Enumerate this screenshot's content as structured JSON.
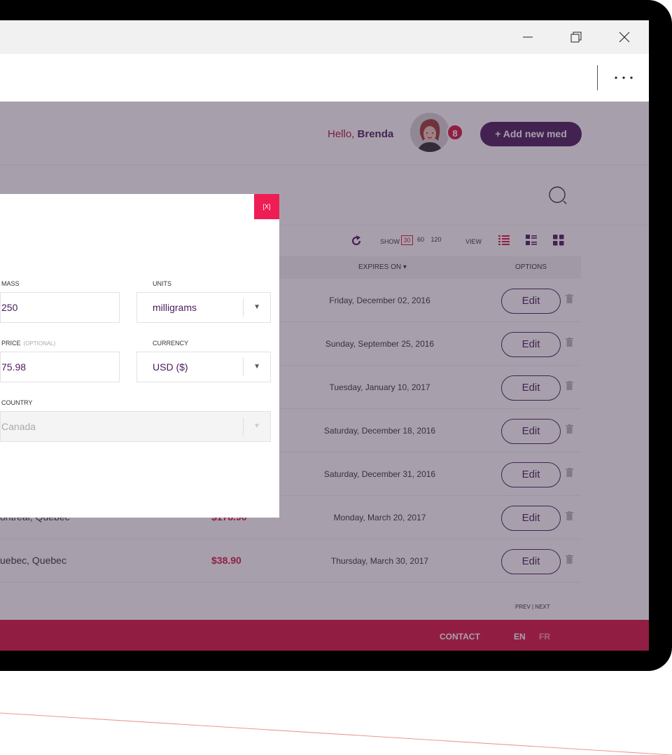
{
  "header": {
    "greeting": "Hello,",
    "user_name": "Brenda",
    "notification_count": "8",
    "add_button": "+ Add new med"
  },
  "toolbar": {
    "show_label": "SHOW",
    "show_options": [
      "30",
      "60",
      "120"
    ],
    "show_selected": "30",
    "view_label": "VIEW"
  },
  "table": {
    "columns": {
      "expires": "EXPIRES ON ▾",
      "options": "OPTIONS"
    },
    "rows": [
      {
        "location": "",
        "price": "",
        "expires": "Friday, December 02, 2016",
        "edit": "Edit"
      },
      {
        "location": "",
        "price": "",
        "expires": "Sunday, September 25, 2016",
        "edit": "Edit"
      },
      {
        "location": "",
        "price": "",
        "expires": "Tuesday, January 10, 2017",
        "edit": "Edit"
      },
      {
        "location": "",
        "price": "",
        "expires": "Saturday, December 18, 2016",
        "edit": "Edit"
      },
      {
        "location": "",
        "price": "",
        "expires": "Saturday, December 31, 2016",
        "edit": "Edit"
      },
      {
        "location": "ontreal, Quebec",
        "price": "$178.90",
        "expires": "Monday, March 20, 2017",
        "edit": "Edit"
      },
      {
        "location": "uebec, Quebec",
        "price": "$38.90",
        "expires": "Thursday, March 30, 2017",
        "edit": "Edit"
      }
    ],
    "pager": "PREV | NEXT"
  },
  "footer": {
    "contact": "CONTACT",
    "lang_en": "EN",
    "lang_fr": "FR"
  },
  "modal": {
    "close": "[X]",
    "mass_label": "MASS",
    "mass_value": "250",
    "units_label": "UNITS",
    "units_value": "milligrams",
    "price_label": "PRICE",
    "price_optional": "(OPTIONAL)",
    "price_value": "75.98",
    "currency_label": "CURRENCY",
    "currency_value": "USD ($)",
    "country_label": "COUNTRY",
    "country_value": "Canada"
  },
  "colors": {
    "accent": "#d7133f",
    "brand": "#4a1a5c",
    "close": "#ee1e54"
  }
}
